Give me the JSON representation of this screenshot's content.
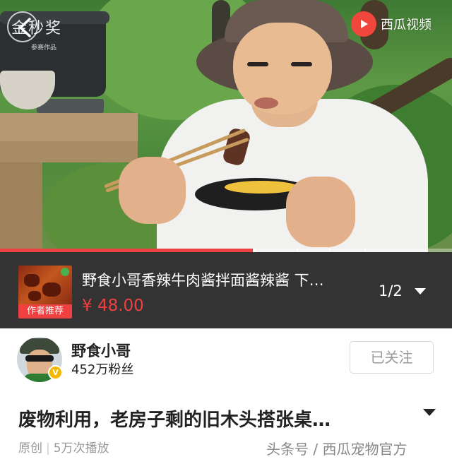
{
  "video": {
    "watermark_logo": "金秒奖",
    "watermark_logo_sub": "参赛作品",
    "app_badge": "西瓜视频",
    "progress": {
      "segment_count": 4
    }
  },
  "product": {
    "tag": "作者推荐",
    "title": "野食小哥香辣牛肉酱拌面酱辣酱 下…",
    "price": "¥ 48.00",
    "pager": "1/2"
  },
  "author": {
    "name": "野食小哥",
    "fans": "452万粉丝",
    "follow_label": "已关注",
    "verified_mark": "V"
  },
  "post": {
    "title": "废物利用，老房子剩的旧木头搭张桌…",
    "label_original": "原创",
    "separator": "|",
    "plays": "5万次播放"
  },
  "footer_watermark": "头条号 / 西瓜宠物官方",
  "colors": {
    "accent": "#f04142",
    "product_bar_bg": "#333333",
    "verified": "#f5b800"
  }
}
